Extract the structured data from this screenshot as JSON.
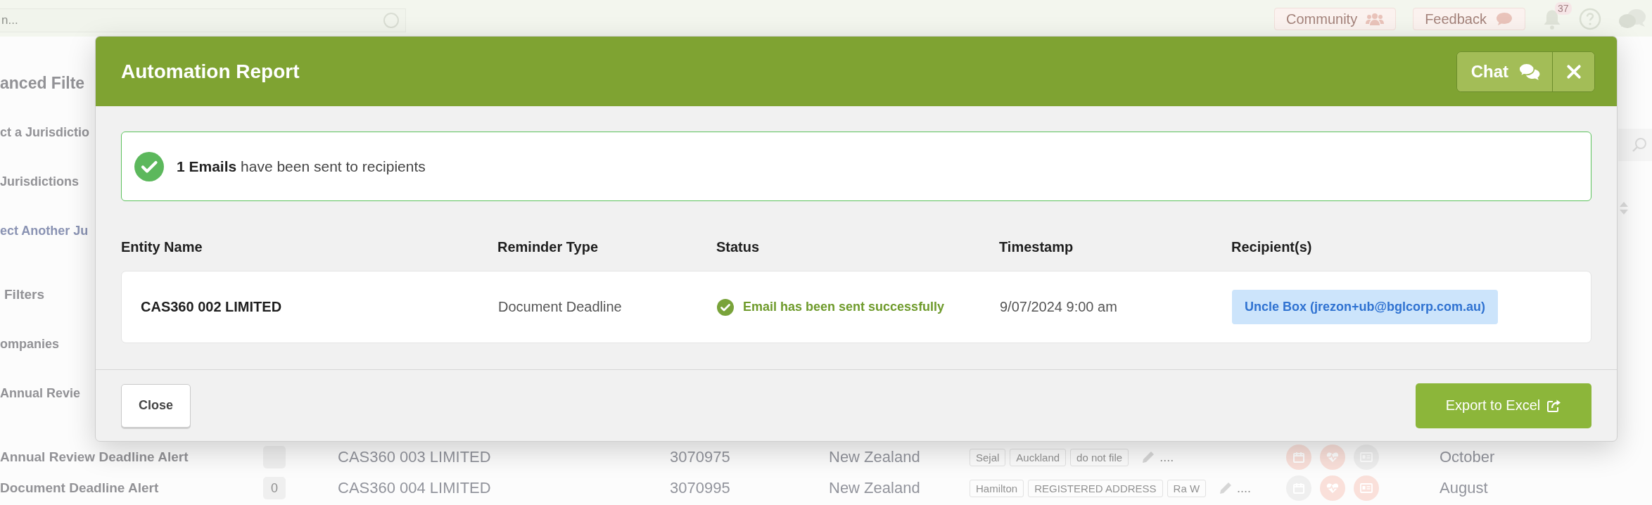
{
  "page": {
    "topbar": {
      "search": {
        "value": "n..."
      },
      "buttons": [
        {
          "label": "Community"
        },
        {
          "label": "Feedback"
        }
      ],
      "notifications": {
        "count": "37"
      }
    },
    "sidebar": {
      "items": [
        {
          "text": "anced Filte",
          "kind": "title"
        },
        {
          "text": "ct a Jurisdictio",
          "kind": "label"
        },
        {
          "text": "Jurisdictions",
          "kind": "label"
        },
        {
          "text": "ect Another Ju",
          "kind": "link"
        },
        {
          "text": "Filters",
          "kind": "section"
        },
        {
          "text": "ompanies",
          "kind": "label"
        },
        {
          "text": "Annual Revie",
          "kind": "label"
        }
      ]
    },
    "rows": [
      {
        "reminder": "Annual Review Deadline Alert",
        "company": "CAS360 003 LIMITED",
        "number": "3070975",
        "country": "New Zealand",
        "tags": [
          "Sejal",
          "Auckland",
          "do not file"
        ],
        "more": "....",
        "status_icons": [
          {
            "color": "#fae0da"
          },
          {
            "color": "#fae0da"
          },
          {
            "color": "#efefef"
          }
        ],
        "month": "October"
      },
      {
        "reminder": "Document Deadline Alert",
        "count": "0",
        "company": "CAS360 004 LIMITED",
        "number": "3070995",
        "country": "New Zealand",
        "tags": [
          "Hamilton",
          "REGISTERED ADDRESS",
          "Ra W"
        ],
        "more": "....",
        "status_icons": [
          {
            "color": "#efefef"
          },
          {
            "color": "#fae0da"
          },
          {
            "color": "#fae0da"
          }
        ],
        "month": "August"
      }
    ]
  },
  "modal": {
    "title": "Automation Report",
    "chat_button": {
      "label": "Chat"
    },
    "alert": {
      "text": "**1 Emails** have been sent to recipients"
    },
    "table": {
      "columns": [
        "Entity Name",
        "Reminder Type",
        "Status",
        "Timestamp",
        "Recipient(s)"
      ],
      "rows": [
        {
          "entity": "CAS360 002 LIMITED",
          "reminder_type": "Document Deadline",
          "status": {
            "kind": "success",
            "text": "Email has been sent successfully"
          },
          "timestamp": "9/07/2024 9:00 am",
          "recipients": [
            "Uncle Box (jrezon+ub@bglcorp.com.au)"
          ]
        }
      ]
    },
    "footer": {
      "close": "Close",
      "export": "Export to Excel"
    }
  }
}
